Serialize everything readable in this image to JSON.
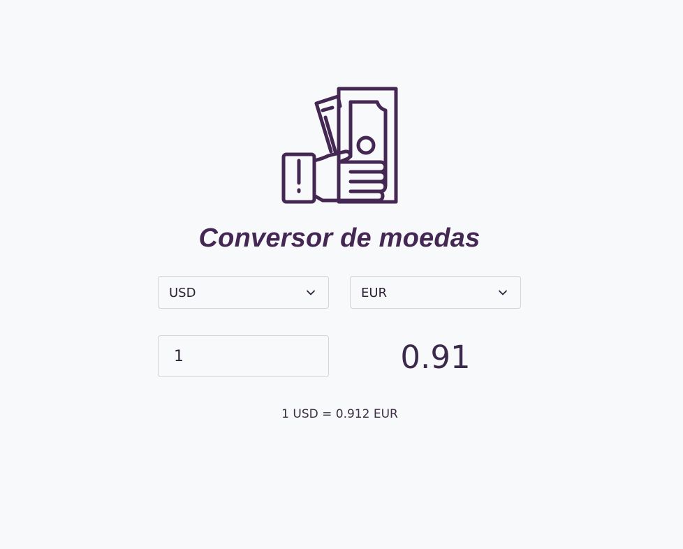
{
  "app": {
    "title": "Conversor de moedas",
    "logo_icon": "money-hand-icon"
  },
  "converter": {
    "from_currency": "USD",
    "to_currency": "EUR",
    "amount": "1",
    "result": "0.91",
    "rate_text": "1 USD = 0.912 EUR"
  },
  "colors": {
    "accent": "#442752",
    "background": "#f8f9fb",
    "border": "#d4d4d8"
  }
}
